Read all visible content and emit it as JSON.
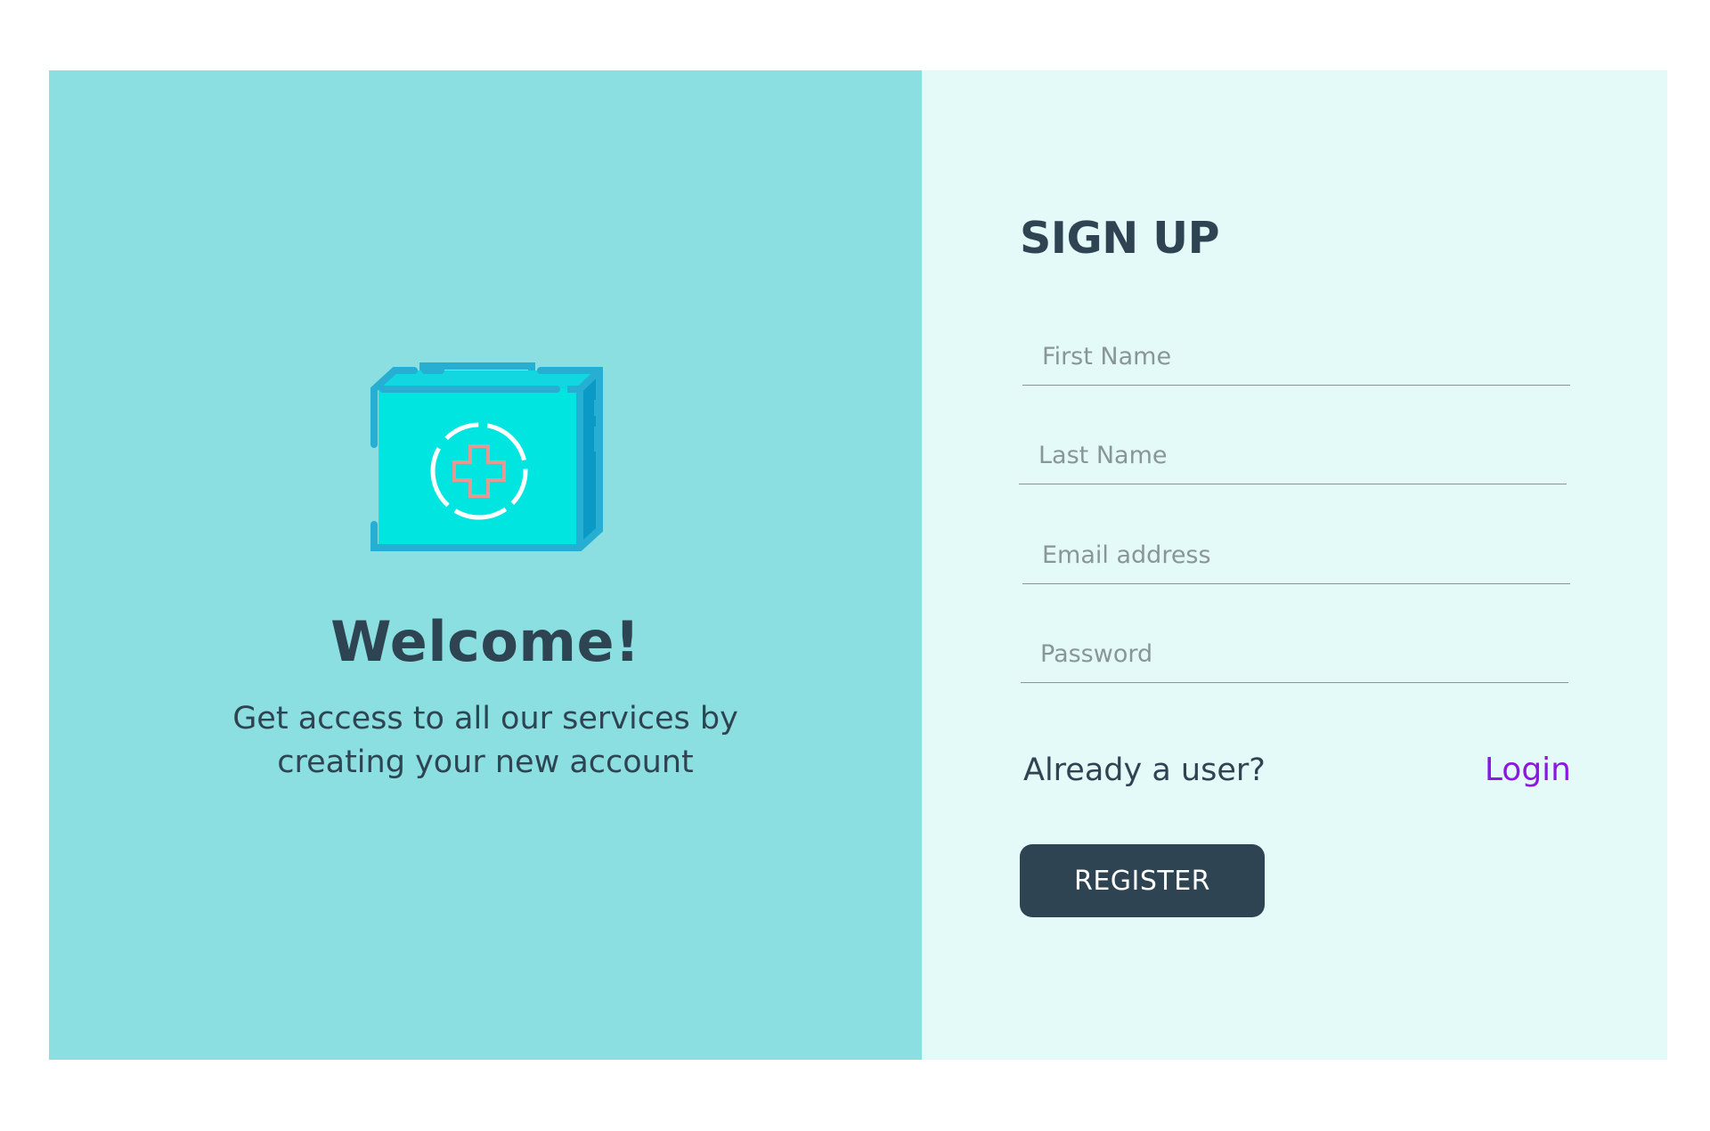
{
  "welcome": {
    "title": "Welcome!",
    "subtitle": "Get access to all our services by creating your new account"
  },
  "illustration": {
    "icon": "first-aid-kit-icon"
  },
  "signup": {
    "title": "SIGN UP",
    "fields": {
      "first_name": {
        "placeholder": "First Name",
        "value": ""
      },
      "last_name": {
        "placeholder": "Last Name",
        "value": ""
      },
      "email": {
        "placeholder": "Email address",
        "value": ""
      },
      "password": {
        "placeholder": "Password",
        "value": ""
      }
    },
    "already_user_text": "Already a user?",
    "login_label": "Login",
    "register_label": "REGISTER"
  },
  "colors": {
    "left_panel_bg": "#8cdfe1",
    "right_panel_bg": "#e3faf8",
    "text_dark": "#2e4452",
    "link_purple": "#8b17e6",
    "button_bg": "#2e4452"
  }
}
